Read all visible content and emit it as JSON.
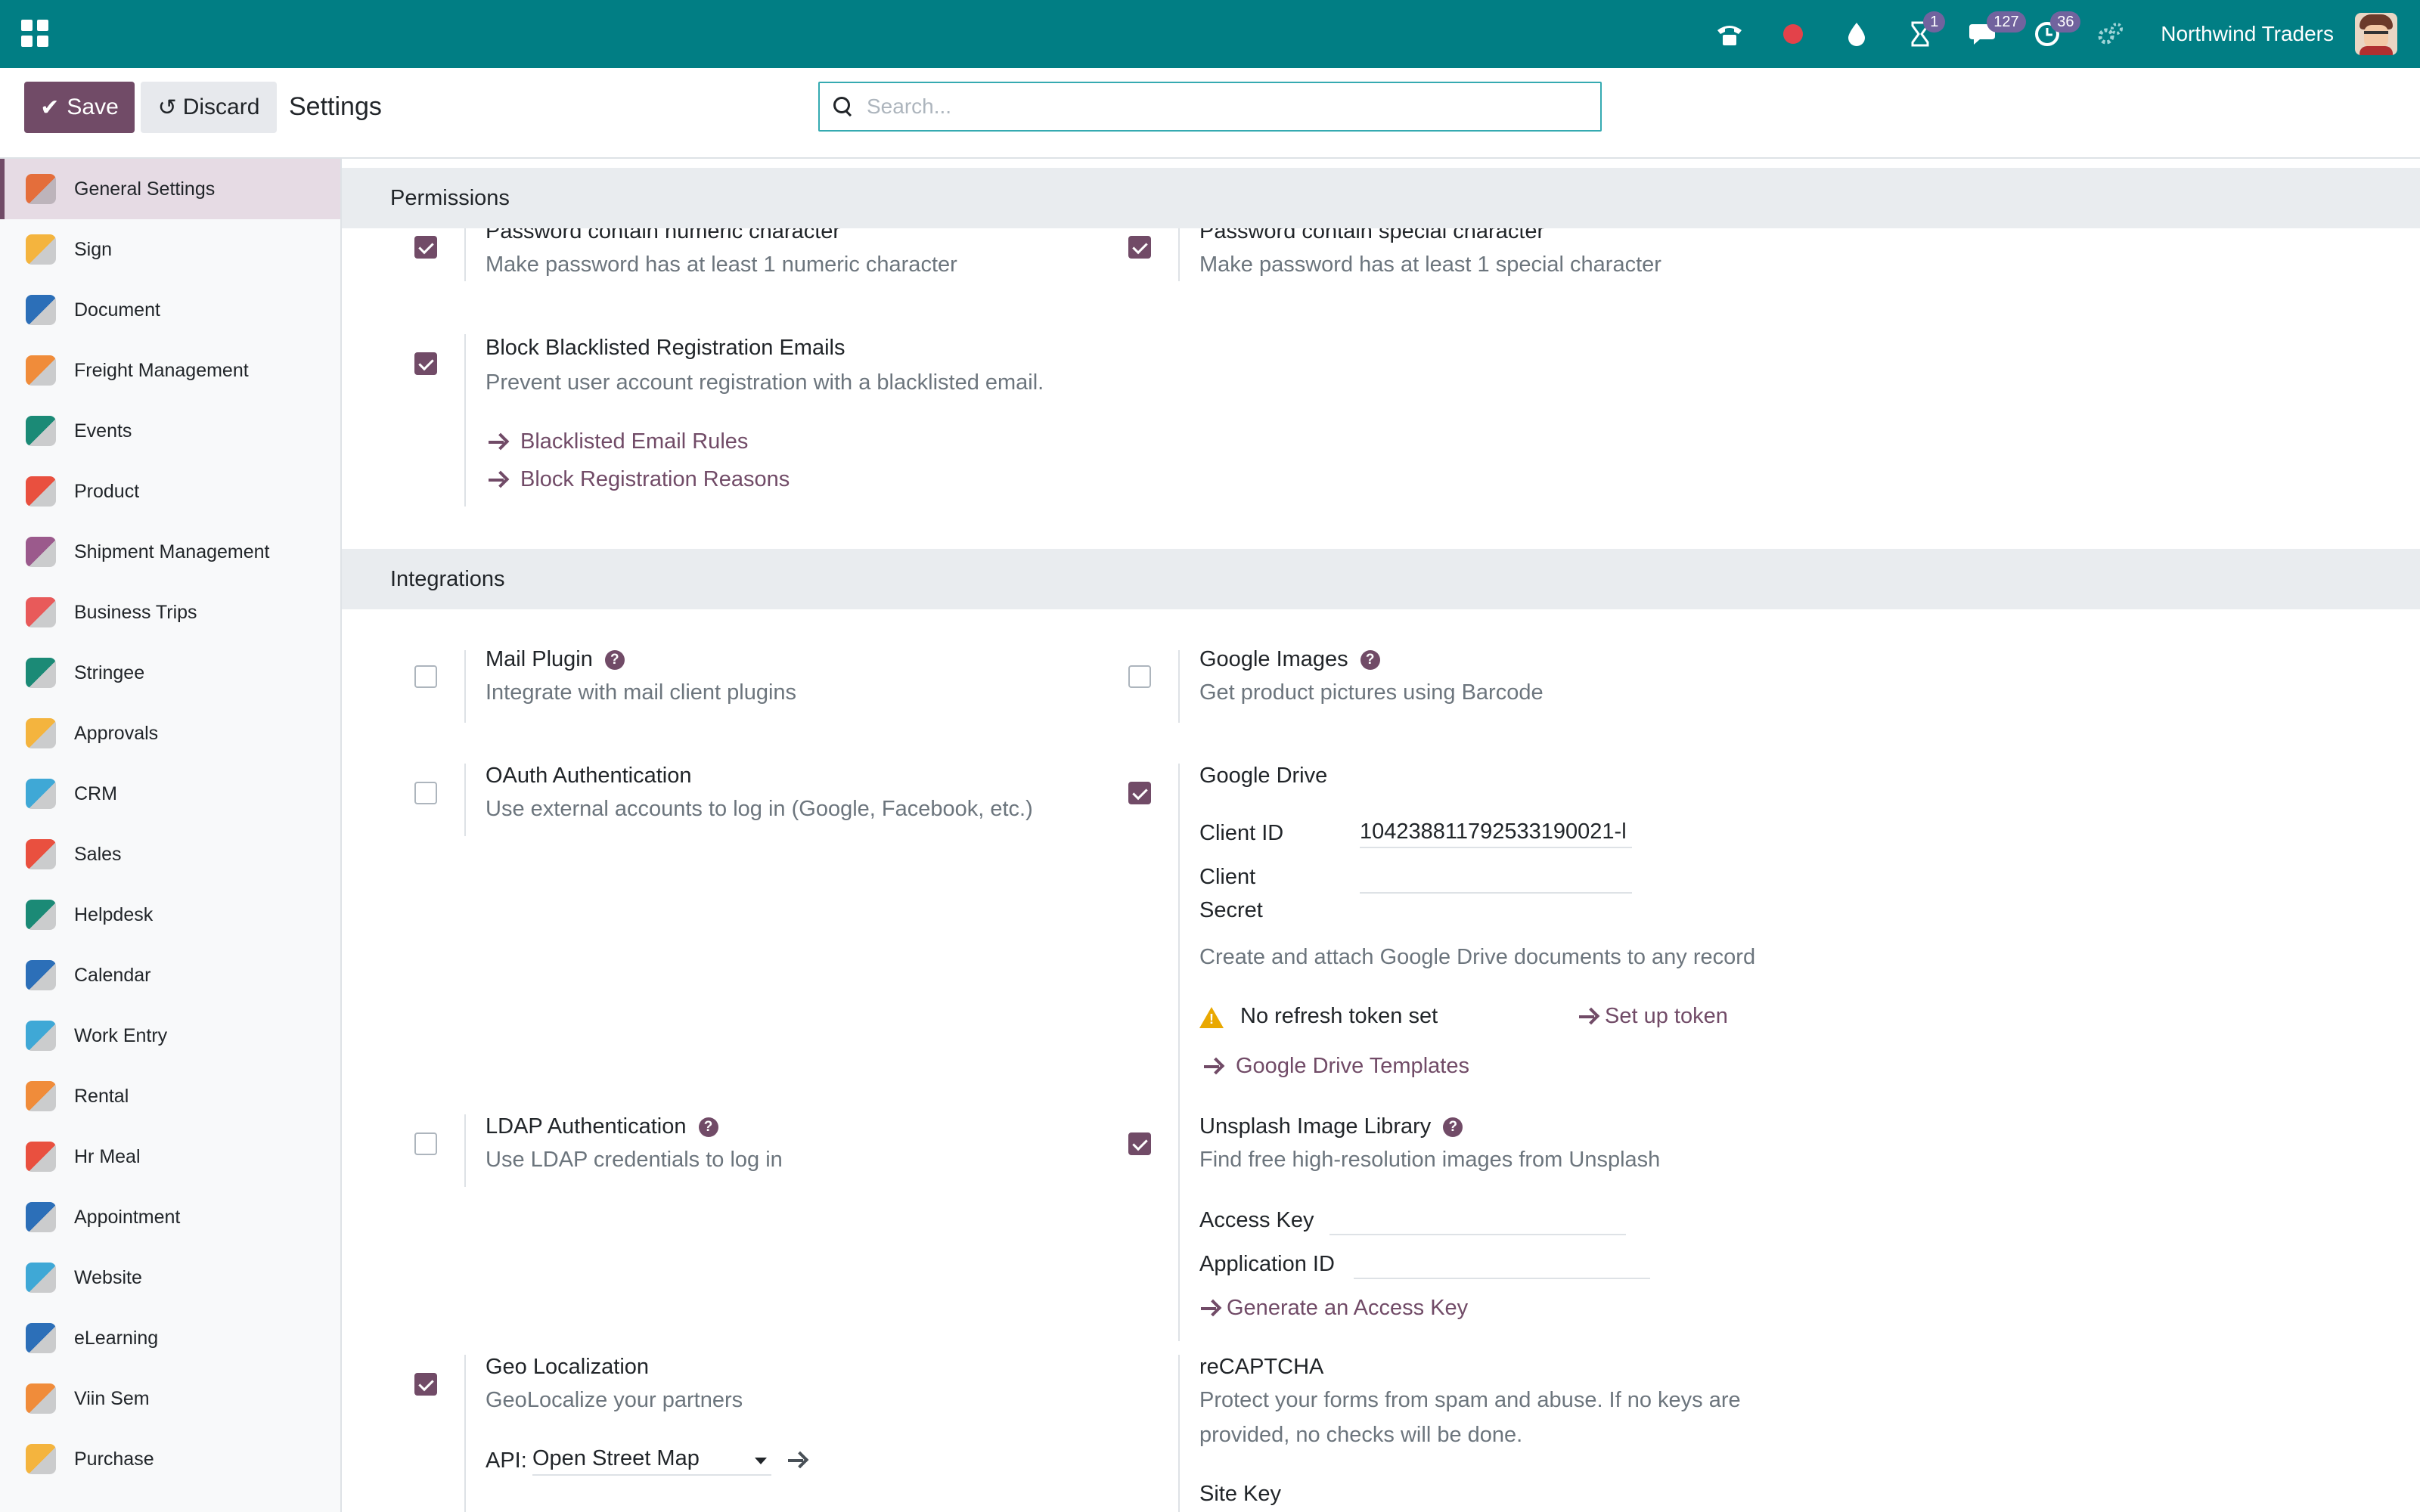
{
  "navbar": {
    "company": "Northwind Traders",
    "badges": {
      "activities": "1",
      "messages": "127",
      "timer": "36"
    },
    "icons": [
      "phone-icon",
      "record-icon",
      "drop-icon",
      "hourglass-icon",
      "chat-icon",
      "clock-icon",
      "settings-icon"
    ]
  },
  "control": {
    "save_label": "Save",
    "discard_label": "Discard",
    "title": "Settings",
    "search_placeholder": "Search..."
  },
  "sidebar": {
    "items": [
      {
        "label": "General Settings",
        "icon": "settings-app-icon",
        "color": "#e46e3b",
        "active": true
      },
      {
        "label": "Sign",
        "icon": "sign-app-icon",
        "color": "#f4b43e"
      },
      {
        "label": "Document",
        "icon": "document-app-icon",
        "color": "#2c6fb8"
      },
      {
        "label": "Freight Management",
        "icon": "freight-app-icon",
        "color": "#f08c3a"
      },
      {
        "label": "Events",
        "icon": "events-app-icon",
        "color": "#1b8a76"
      },
      {
        "label": "Product",
        "icon": "product-app-icon",
        "color": "#e9503f"
      },
      {
        "label": "Shipment Management",
        "icon": "shipment-app-icon",
        "color": "#9b5a8c"
      },
      {
        "label": "Business Trips",
        "icon": "trips-app-icon",
        "color": "#e85a5a"
      },
      {
        "label": "Stringee",
        "icon": "stringee-app-icon",
        "color": "#1b8a76"
      },
      {
        "label": "Approvals",
        "icon": "approvals-app-icon",
        "color": "#f4b43e"
      },
      {
        "label": "CRM",
        "icon": "crm-app-icon",
        "color": "#3fa8d6"
      },
      {
        "label": "Sales",
        "icon": "sales-app-icon",
        "color": "#e9503f"
      },
      {
        "label": "Helpdesk",
        "icon": "helpdesk-app-icon",
        "color": "#1b8a76"
      },
      {
        "label": "Calendar",
        "icon": "calendar-app-icon",
        "color": "#2c6fb8"
      },
      {
        "label": "Work Entry",
        "icon": "work-entry-app-icon",
        "color": "#3fa8d6"
      },
      {
        "label": "Rental",
        "icon": "rental-app-icon",
        "color": "#f08c3a"
      },
      {
        "label": "Hr Meal",
        "icon": "meal-app-icon",
        "color": "#e9503f"
      },
      {
        "label": "Appointment",
        "icon": "appointment-app-icon",
        "color": "#2c6fb8"
      },
      {
        "label": "Website",
        "icon": "website-app-icon",
        "color": "#3fa8d6"
      },
      {
        "label": "eLearning",
        "icon": "elearning-app-icon",
        "color": "#2c6fb8"
      },
      {
        "label": "Viin Sem",
        "icon": "viin-sem-app-icon",
        "color": "#f08c3a"
      },
      {
        "label": "Purchase",
        "icon": "purchase-app-icon",
        "color": "#f4b43e"
      }
    ]
  },
  "permissions": {
    "heading": "Permissions",
    "numeric": {
      "title": "Password contain numeric character",
      "desc": "Make password has at least 1 numeric character",
      "checked": true
    },
    "special": {
      "title": "Password contain special character",
      "desc": "Make password has at least 1 special character",
      "checked": true
    },
    "blacklist": {
      "title": "Block Blacklisted Registration Emails",
      "desc": "Prevent user account registration with a blacklisted email.",
      "checked": true,
      "link1": "Blacklisted Email Rules",
      "link2": "Block Registration Reasons"
    }
  },
  "integrations": {
    "heading": "Integrations",
    "mail_plugin": {
      "title": "Mail Plugin",
      "desc": "Integrate with mail client plugins",
      "checked": false
    },
    "google_images": {
      "title": "Google Images",
      "desc": "Get product pictures using Barcode",
      "checked": false
    },
    "oauth": {
      "title": "OAuth Authentication",
      "desc": "Use external accounts to log in (Google, Facebook, etc.)",
      "checked": false
    },
    "google_drive": {
      "title": "Google Drive",
      "checked": true,
      "client_id_label": "Client ID",
      "client_id_value": "104238811792533190021-l",
      "client_secret_label_1": "Client",
      "client_secret_label_2": "Secret",
      "client_secret_value": "",
      "desc": "Create and attach Google Drive documents to any record",
      "warning": "No refresh token set",
      "setup_link": "Set up token",
      "templates_link": "Google Drive Templates"
    },
    "ldap": {
      "title": "LDAP Authentication",
      "desc": "Use LDAP credentials to log in",
      "checked": false
    },
    "unsplash": {
      "title": "Unsplash Image Library",
      "desc": "Find free high-resolution images from Unsplash",
      "checked": true,
      "access_key_label": "Access Key",
      "access_key_value": "",
      "app_id_label": "Application ID",
      "app_id_value": "",
      "generate_link": "Generate an Access Key"
    },
    "geo": {
      "title": "Geo Localization",
      "desc": "GeoLocalize your partners",
      "checked": true,
      "api_label": "API:",
      "api_value": "Open Street Map"
    },
    "recaptcha": {
      "title": "reCAPTCHA",
      "desc_1": "Protect your forms from spam and abuse. If no keys are",
      "desc_2": "provided, no checks will be done.",
      "site_key_label": "Site Key"
    }
  }
}
